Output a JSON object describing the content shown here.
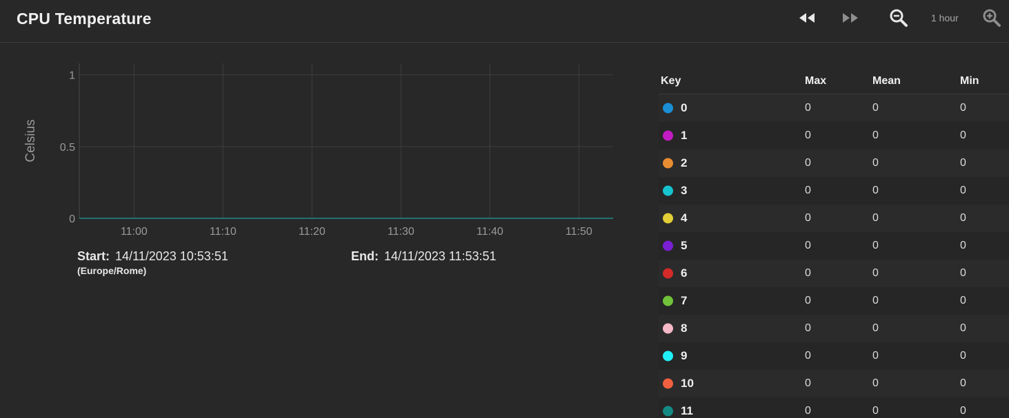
{
  "header": {
    "title": "CPU Temperature",
    "range_label": "1 hour"
  },
  "icons": {
    "rewind": "rewind-icon",
    "forward": "fast-forward-icon",
    "zoom_out": "zoom-out-icon",
    "zoom_in": "zoom-in-icon"
  },
  "chart_data": {
    "type": "line",
    "ylabel": "Celsius",
    "xlabel": "",
    "y_ticks": [
      "1",
      "0.5",
      "0"
    ],
    "y_tick_values": [
      1,
      0.5,
      0
    ],
    "ylim": [
      0,
      1.08
    ],
    "x_ticks": [
      "11:00",
      "11:10",
      "11:20",
      "11:30",
      "11:40",
      "11:50"
    ],
    "x_range": [
      "10:53:51",
      "11:53:51"
    ],
    "grid": true,
    "series_value": 0,
    "line_color": "#1f8a8a"
  },
  "time_range": {
    "start_label": "Start:",
    "start_value": "14/11/2023 10:53:51",
    "timezone": "(Europe/Rome)",
    "end_label": "End:",
    "end_value": "14/11/2023 11:53:51"
  },
  "legend": {
    "headers": {
      "key": "Key",
      "max": "Max",
      "mean": "Mean",
      "min": "Min"
    },
    "rows": [
      {
        "name": "0",
        "color": "#1a8fd6",
        "max": "0",
        "mean": "0",
        "min": "0"
      },
      {
        "name": "1",
        "color": "#c21bc2",
        "max": "0",
        "mean": "0",
        "min": "0"
      },
      {
        "name": "2",
        "color": "#e98d32",
        "max": "0",
        "mean": "0",
        "min": "0"
      },
      {
        "name": "3",
        "color": "#16c4d0",
        "max": "0",
        "mean": "0",
        "min": "0"
      },
      {
        "name": "4",
        "color": "#e2cf37",
        "max": "0",
        "mean": "0",
        "min": "0"
      },
      {
        "name": "5",
        "color": "#7a1fd2",
        "max": "0",
        "mean": "0",
        "min": "0"
      },
      {
        "name": "6",
        "color": "#d42a2a",
        "max": "0",
        "mean": "0",
        "min": "0"
      },
      {
        "name": "7",
        "color": "#70c23a",
        "max": "0",
        "mean": "0",
        "min": "0"
      },
      {
        "name": "8",
        "color": "#f5b8c6",
        "max": "0",
        "mean": "0",
        "min": "0"
      },
      {
        "name": "9",
        "color": "#1ff0f5",
        "max": "0",
        "mean": "0",
        "min": "0"
      },
      {
        "name": "10",
        "color": "#f06040",
        "max": "0",
        "mean": "0",
        "min": "0"
      },
      {
        "name": "11",
        "color": "#138a84",
        "max": "0",
        "mean": "0",
        "min": "0"
      }
    ]
  }
}
